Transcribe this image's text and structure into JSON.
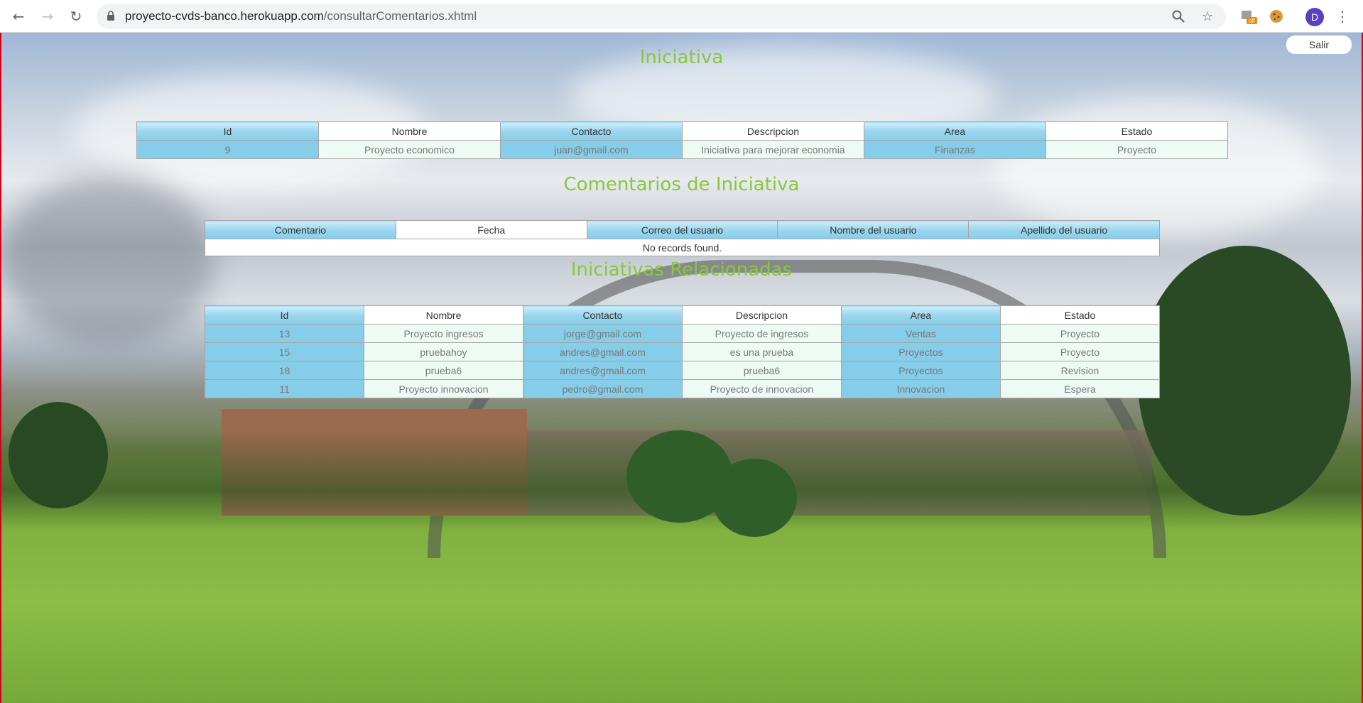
{
  "browser": {
    "url_host": "proyecto-cvds-banco.herokuapp.com",
    "url_path": "/consultarComentarios.xhtml",
    "extension_badge": "off",
    "avatar_letter": "D"
  },
  "page": {
    "salir_label": "Salir",
    "iniciativa": {
      "title": "Iniciativa",
      "columns": [
        "Id",
        "Nombre",
        "Contacto",
        "Descripcion",
        "Area",
        "Estado"
      ],
      "rows": [
        [
          "9",
          "Proyecto economico",
          "juan@gmail.com",
          "Iniciativa para mejorar economia",
          "Finanzas",
          "Proyecto"
        ]
      ]
    },
    "comentarios": {
      "title": "Comentarios de Iniciativa",
      "columns": [
        "Comentario",
        "Fecha",
        "Correo del usuario",
        "Nombre del usuario",
        "Apellido del usuario"
      ],
      "empty_message": "No records found."
    },
    "relacionadas": {
      "title": "Iniciativas Relacionadas",
      "columns": [
        "Id",
        "Nombre",
        "Contacto",
        "Descripcion",
        "Area",
        "Estado"
      ],
      "rows": [
        [
          "13",
          "Proyecto ingresos",
          "jorge@gmail.com",
          "Proyecto de ingresos",
          "Ventas",
          "Proyecto"
        ],
        [
          "15",
          "pruebahoy",
          "andres@gmail.com",
          "es una prueba",
          "Proyectos",
          "Proyecto"
        ],
        [
          "18",
          "prueba6",
          "andres@gmail.com",
          "prueba6",
          "Proyectos",
          "Revision"
        ],
        [
          "11",
          "Proyecto innovacion",
          "pedro@gmail.com",
          "Proyecto de innovacion",
          "Innovacion",
          "Espera"
        ]
      ]
    }
  },
  "colors": {
    "heading": "#8cc63e",
    "header_blue": "#85cde9",
    "row_mint": "#eefbf5"
  }
}
